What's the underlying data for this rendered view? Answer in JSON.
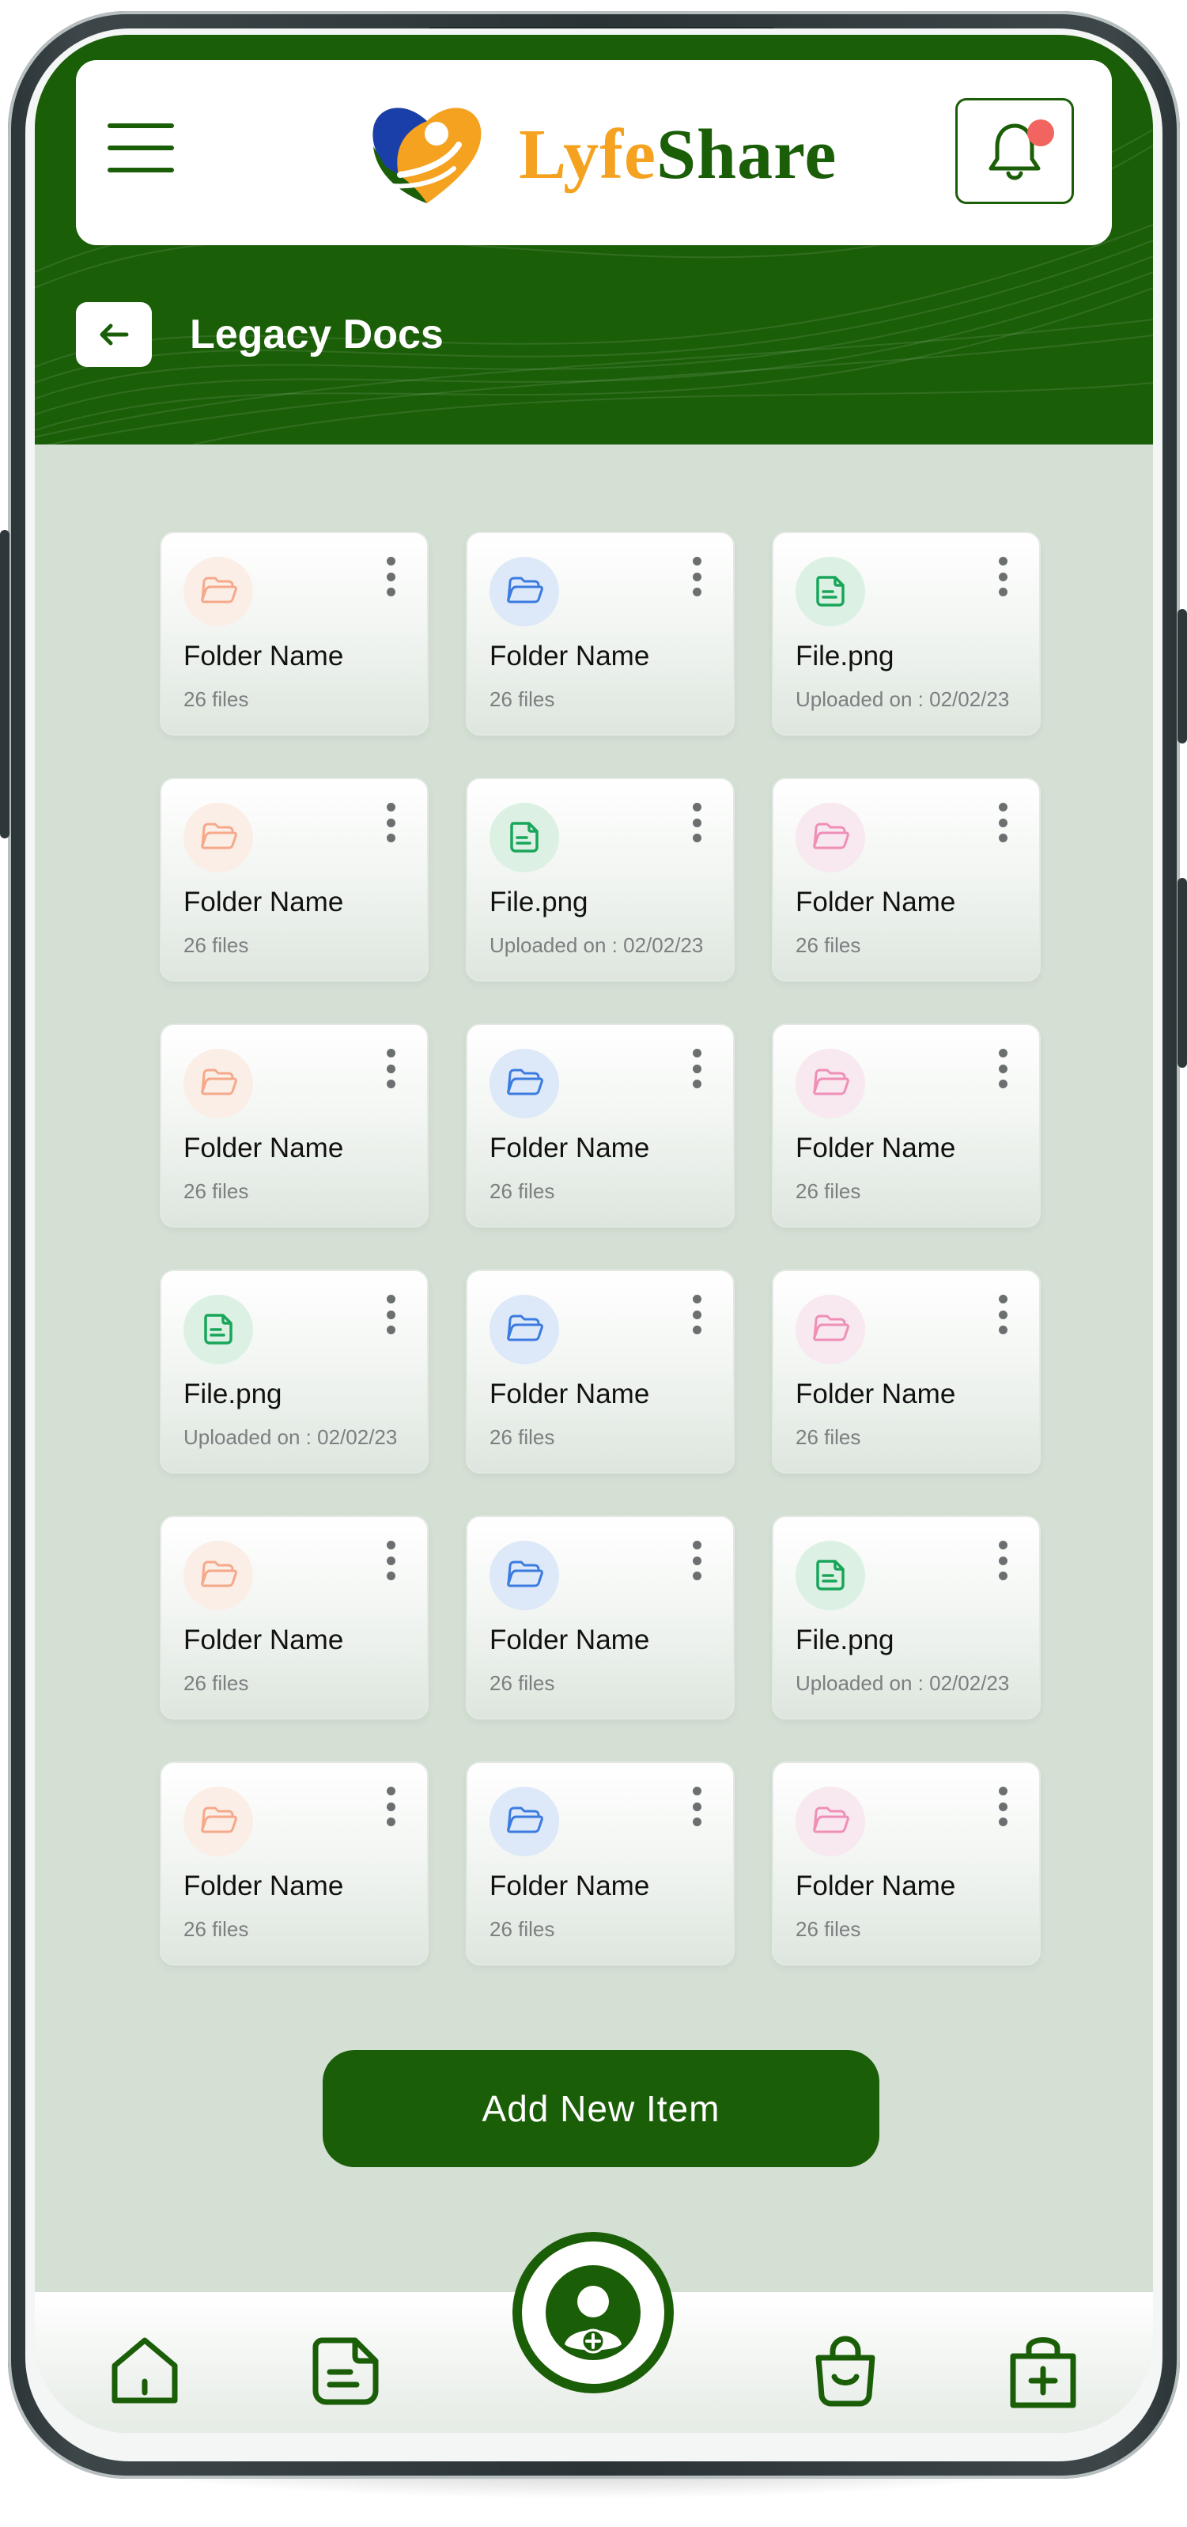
{
  "app": {
    "brand_part1": "Lyfe",
    "brand_part2": "Share",
    "accent_color": "#1b5e08",
    "brand_orange": "#f4a21f",
    "notification_dot_color": "#f2645f"
  },
  "page": {
    "title": "Legacy Docs",
    "back_icon": "arrow-left-icon",
    "menu_icon": "hamburger-icon",
    "notification_icon": "bell-icon"
  },
  "items": [
    {
      "kind": "folder",
      "color": "orange",
      "name": "Folder Name",
      "meta": "26 files"
    },
    {
      "kind": "folder",
      "color": "blue",
      "name": "Folder Name",
      "meta": "26 files"
    },
    {
      "kind": "file",
      "color": "green",
      "name": "File.png",
      "meta": "Uploaded on : 02/02/23"
    },
    {
      "kind": "folder",
      "color": "orange",
      "name": "Folder Name",
      "meta": "26 files"
    },
    {
      "kind": "file",
      "color": "green",
      "name": "File.png",
      "meta": "Uploaded on : 02/02/23"
    },
    {
      "kind": "folder",
      "color": "pink",
      "name": "Folder Name",
      "meta": "26 files"
    },
    {
      "kind": "folder",
      "color": "orange",
      "name": "Folder Name",
      "meta": "26 files"
    },
    {
      "kind": "folder",
      "color": "blue",
      "name": "Folder Name",
      "meta": "26 files"
    },
    {
      "kind": "folder",
      "color": "pink",
      "name": "Folder Name",
      "meta": "26 files"
    },
    {
      "kind": "file",
      "color": "green",
      "name": "File.png",
      "meta": "Uploaded on : 02/02/23"
    },
    {
      "kind": "folder",
      "color": "blue",
      "name": "Folder Name",
      "meta": "26 files"
    },
    {
      "kind": "folder",
      "color": "pink",
      "name": "Folder Name",
      "meta": "26 files"
    },
    {
      "kind": "folder",
      "color": "orange",
      "name": "Folder Name",
      "meta": "26 files"
    },
    {
      "kind": "folder",
      "color": "blue",
      "name": "Folder Name",
      "meta": "26 files"
    },
    {
      "kind": "file",
      "color": "green",
      "name": "File.png",
      "meta": "Uploaded on : 02/02/23"
    },
    {
      "kind": "folder",
      "color": "orange",
      "name": "Folder Name",
      "meta": "26 files"
    },
    {
      "kind": "folder",
      "color": "blue",
      "name": "Folder Name",
      "meta": "26 files"
    },
    {
      "kind": "folder",
      "color": "pink",
      "name": "Folder Name",
      "meta": "26 files"
    }
  ],
  "icon_colors": {
    "orange": {
      "fg": "#f5a98a",
      "bg": "#fbeee6"
    },
    "blue": {
      "fg": "#3b7be0",
      "bg": "#dde8f8"
    },
    "pink": {
      "fg": "#ef8fb7",
      "bg": "#f8e8ef"
    },
    "green": {
      "fg": "#19a55a",
      "bg": "#dcf1e3"
    }
  },
  "actions": {
    "add_label": "Add  New Item"
  },
  "bottom_nav": [
    {
      "id": "home",
      "icon": "home-icon"
    },
    {
      "id": "documents",
      "icon": "document-icon"
    },
    {
      "id": "profile",
      "icon": "user-add-icon"
    },
    {
      "id": "shop",
      "icon": "shopping-bag-icon"
    },
    {
      "id": "medical",
      "icon": "medical-bag-icon"
    }
  ]
}
